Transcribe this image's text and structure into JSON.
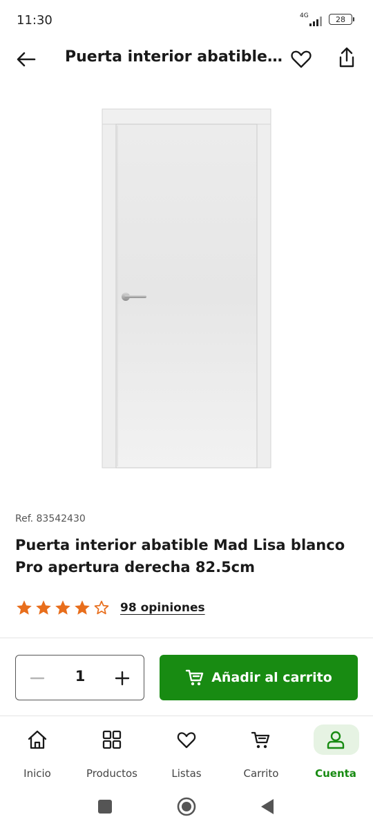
{
  "status_bar": {
    "time": "11:30",
    "network": "4G",
    "battery": "28"
  },
  "header": {
    "title": "Puerta interior abatible…",
    "icons": [
      "back-arrow-icon",
      "heart-icon",
      "share-icon"
    ]
  },
  "product": {
    "ref": "Ref. 83542430",
    "name": "Puerta interior abatible Mad Lisa blanco Pro apertura derecha 82.5cm",
    "rating": 4.5,
    "rating_max": 5,
    "reviews_label": "98 opiniones",
    "star_color": "#e86e1c"
  },
  "purchase": {
    "quantity": "1",
    "add_to_cart_label": "Añadir al carrito",
    "button_color": "#188b12"
  },
  "bottom_nav": {
    "items": [
      {
        "label": "Inicio",
        "icon": "home-icon"
      },
      {
        "label": "Productos",
        "icon": "grid-icon"
      },
      {
        "label": "Listas",
        "icon": "heart-icon"
      },
      {
        "label": "Carrito",
        "icon": "cart-icon"
      },
      {
        "label": "Cuenta",
        "icon": "user-icon",
        "active": true
      }
    ]
  },
  "system_nav": {
    "icons": [
      "recent-apps-icon",
      "home-circle-icon",
      "back-triangle-icon"
    ]
  }
}
